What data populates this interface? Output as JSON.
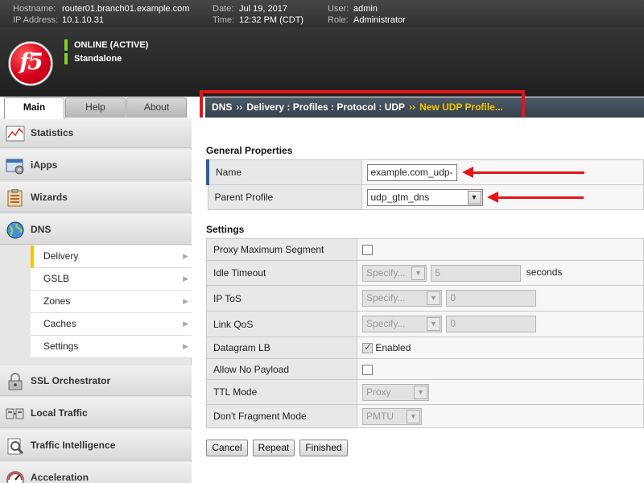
{
  "header": {
    "hostname_label": "Hostname:",
    "hostname": "router01.branch01.example.com",
    "ip_label": "IP Address:",
    "ip": "10.1.10.31",
    "date_label": "Date:",
    "date": "Jul 19, 2017",
    "time_label": "Time:",
    "time": "12:32 PM (CDT)",
    "user_label": "User:",
    "user": "admin",
    "role_label": "Role:",
    "role": "Administrator",
    "status_online": "ONLINE (ACTIVE)",
    "status_mode": "Standalone",
    "logo_text": "f5"
  },
  "tabs": [
    {
      "label": "Main",
      "active": true
    },
    {
      "label": "Help",
      "active": false
    },
    {
      "label": "About",
      "active": false
    }
  ],
  "breadcrumb": {
    "path": "DNS",
    "sep": "››",
    "section": "Delivery : Profiles : Protocol : UDP",
    "current": "New UDP Profile..."
  },
  "sidebar": {
    "sections": [
      {
        "label": "Statistics",
        "icon": "statistics-icon"
      },
      {
        "label": "iApps",
        "icon": "iapps-icon"
      },
      {
        "label": "Wizards",
        "icon": "wizards-icon"
      },
      {
        "label": "DNS",
        "icon": "globe-icon"
      },
      {
        "label": "SSL Orchestrator",
        "icon": "lock-icon"
      },
      {
        "label": "Local Traffic",
        "icon": "local-traffic-icon"
      },
      {
        "label": "Traffic Intelligence",
        "icon": "traffic-intelligence-icon"
      },
      {
        "label": "Acceleration",
        "icon": "gauge-icon"
      }
    ],
    "dns_items": [
      {
        "label": "Delivery",
        "selected": true
      },
      {
        "label": "GSLB",
        "selected": false
      },
      {
        "label": "Zones",
        "selected": false
      },
      {
        "label": "Caches",
        "selected": false
      },
      {
        "label": "Settings",
        "selected": false
      }
    ]
  },
  "general": {
    "title": "General Properties",
    "name_label": "Name",
    "name_value": "example.com_udp-",
    "parent_label": "Parent Profile",
    "parent_value": "udp_gtm_dns"
  },
  "settings": {
    "title": "Settings",
    "rows": {
      "proxy_max_segment": {
        "label": "Proxy Maximum Segment",
        "checked": false
      },
      "idle_timeout": {
        "label": "Idle Timeout",
        "select": "Specify...",
        "value": "5",
        "unit": "seconds"
      },
      "ip_tos": {
        "label": "IP ToS",
        "select": "Specify...",
        "value": "0"
      },
      "link_qos": {
        "label": "Link QoS",
        "select": "Specify...",
        "value": "0"
      },
      "datagram_lb": {
        "label": "Datagram LB",
        "checked": true,
        "check_label": "Enabled"
      },
      "allow_no_payload": {
        "label": "Allow No Payload",
        "checked": false
      },
      "ttl_mode": {
        "label": "TTL Mode",
        "select": "Proxy"
      },
      "dont_fragment": {
        "label": "Don't Fragment Mode",
        "select": "PMTU"
      }
    }
  },
  "buttons": {
    "cancel": "Cancel",
    "repeat": "Repeat",
    "finished": "Finished"
  },
  "colors": {
    "highlight_red": "#e3151a",
    "breadcrumb_current": "#f5c400",
    "status_green": "#7ed321"
  }
}
